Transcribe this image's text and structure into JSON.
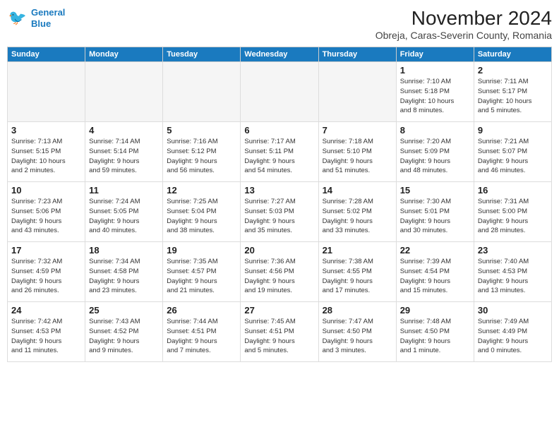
{
  "logo": {
    "line1": "General",
    "line2": "Blue"
  },
  "title": "November 2024",
  "location": "Obreja, Caras-Severin County, Romania",
  "days_of_week": [
    "Sunday",
    "Monday",
    "Tuesday",
    "Wednesday",
    "Thursday",
    "Friday",
    "Saturday"
  ],
  "weeks": [
    [
      {
        "day": "",
        "info": ""
      },
      {
        "day": "",
        "info": ""
      },
      {
        "day": "",
        "info": ""
      },
      {
        "day": "",
        "info": ""
      },
      {
        "day": "",
        "info": ""
      },
      {
        "day": "1",
        "info": "Sunrise: 7:10 AM\nSunset: 5:18 PM\nDaylight: 10 hours\nand 8 minutes."
      },
      {
        "day": "2",
        "info": "Sunrise: 7:11 AM\nSunset: 5:17 PM\nDaylight: 10 hours\nand 5 minutes."
      }
    ],
    [
      {
        "day": "3",
        "info": "Sunrise: 7:13 AM\nSunset: 5:15 PM\nDaylight: 10 hours\nand 2 minutes."
      },
      {
        "day": "4",
        "info": "Sunrise: 7:14 AM\nSunset: 5:14 PM\nDaylight: 9 hours\nand 59 minutes."
      },
      {
        "day": "5",
        "info": "Sunrise: 7:16 AM\nSunset: 5:12 PM\nDaylight: 9 hours\nand 56 minutes."
      },
      {
        "day": "6",
        "info": "Sunrise: 7:17 AM\nSunset: 5:11 PM\nDaylight: 9 hours\nand 54 minutes."
      },
      {
        "day": "7",
        "info": "Sunrise: 7:18 AM\nSunset: 5:10 PM\nDaylight: 9 hours\nand 51 minutes."
      },
      {
        "day": "8",
        "info": "Sunrise: 7:20 AM\nSunset: 5:09 PM\nDaylight: 9 hours\nand 48 minutes."
      },
      {
        "day": "9",
        "info": "Sunrise: 7:21 AM\nSunset: 5:07 PM\nDaylight: 9 hours\nand 46 minutes."
      }
    ],
    [
      {
        "day": "10",
        "info": "Sunrise: 7:23 AM\nSunset: 5:06 PM\nDaylight: 9 hours\nand 43 minutes."
      },
      {
        "day": "11",
        "info": "Sunrise: 7:24 AM\nSunset: 5:05 PM\nDaylight: 9 hours\nand 40 minutes."
      },
      {
        "day": "12",
        "info": "Sunrise: 7:25 AM\nSunset: 5:04 PM\nDaylight: 9 hours\nand 38 minutes."
      },
      {
        "day": "13",
        "info": "Sunrise: 7:27 AM\nSunset: 5:03 PM\nDaylight: 9 hours\nand 35 minutes."
      },
      {
        "day": "14",
        "info": "Sunrise: 7:28 AM\nSunset: 5:02 PM\nDaylight: 9 hours\nand 33 minutes."
      },
      {
        "day": "15",
        "info": "Sunrise: 7:30 AM\nSunset: 5:01 PM\nDaylight: 9 hours\nand 30 minutes."
      },
      {
        "day": "16",
        "info": "Sunrise: 7:31 AM\nSunset: 5:00 PM\nDaylight: 9 hours\nand 28 minutes."
      }
    ],
    [
      {
        "day": "17",
        "info": "Sunrise: 7:32 AM\nSunset: 4:59 PM\nDaylight: 9 hours\nand 26 minutes."
      },
      {
        "day": "18",
        "info": "Sunrise: 7:34 AM\nSunset: 4:58 PM\nDaylight: 9 hours\nand 23 minutes."
      },
      {
        "day": "19",
        "info": "Sunrise: 7:35 AM\nSunset: 4:57 PM\nDaylight: 9 hours\nand 21 minutes."
      },
      {
        "day": "20",
        "info": "Sunrise: 7:36 AM\nSunset: 4:56 PM\nDaylight: 9 hours\nand 19 minutes."
      },
      {
        "day": "21",
        "info": "Sunrise: 7:38 AM\nSunset: 4:55 PM\nDaylight: 9 hours\nand 17 minutes."
      },
      {
        "day": "22",
        "info": "Sunrise: 7:39 AM\nSunset: 4:54 PM\nDaylight: 9 hours\nand 15 minutes."
      },
      {
        "day": "23",
        "info": "Sunrise: 7:40 AM\nSunset: 4:53 PM\nDaylight: 9 hours\nand 13 minutes."
      }
    ],
    [
      {
        "day": "24",
        "info": "Sunrise: 7:42 AM\nSunset: 4:53 PM\nDaylight: 9 hours\nand 11 minutes."
      },
      {
        "day": "25",
        "info": "Sunrise: 7:43 AM\nSunset: 4:52 PM\nDaylight: 9 hours\nand 9 minutes."
      },
      {
        "day": "26",
        "info": "Sunrise: 7:44 AM\nSunset: 4:51 PM\nDaylight: 9 hours\nand 7 minutes."
      },
      {
        "day": "27",
        "info": "Sunrise: 7:45 AM\nSunset: 4:51 PM\nDaylight: 9 hours\nand 5 minutes."
      },
      {
        "day": "28",
        "info": "Sunrise: 7:47 AM\nSunset: 4:50 PM\nDaylight: 9 hours\nand 3 minutes."
      },
      {
        "day": "29",
        "info": "Sunrise: 7:48 AM\nSunset: 4:50 PM\nDaylight: 9 hours\nand 1 minute."
      },
      {
        "day": "30",
        "info": "Sunrise: 7:49 AM\nSunset: 4:49 PM\nDaylight: 9 hours\nand 0 minutes."
      }
    ]
  ]
}
